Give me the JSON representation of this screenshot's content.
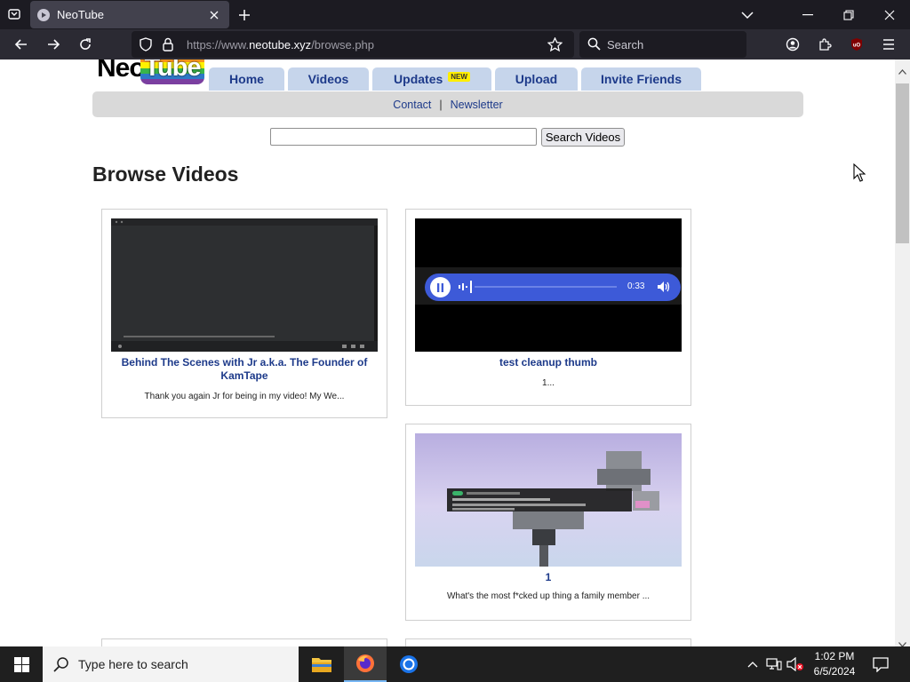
{
  "browser": {
    "tab_title": "NeoTube",
    "url_prefix": "https://www.",
    "url_host": "neotube.xyz",
    "url_path": "/browse.php",
    "search_placeholder": "Search"
  },
  "site": {
    "logo_neo": "Neo",
    "logo_tube": "Tube",
    "logo_colors": [
      "#e23a3a",
      "#f7941d",
      "#fff200",
      "#39b54a",
      "#2e79c7",
      "#7b3fa0"
    ],
    "menu": [
      {
        "label": "Home"
      },
      {
        "label": "Videos"
      },
      {
        "label": "Updates",
        "badge": "NEW"
      },
      {
        "label": "Upload"
      },
      {
        "label": "Invite Friends"
      }
    ],
    "subnav": {
      "contact": "Contact",
      "separator": "|",
      "newsletter": "Newsletter"
    },
    "search_button": "Search Videos",
    "search_value": "",
    "page_title": "Browse Videos"
  },
  "videos": [
    {
      "title": "Behind The Scenes with Jr a.k.a. The Founder of KamTape",
      "description": "Thank you again Jr for being in my video! My We..."
    },
    {
      "title": "test cleanup thumb",
      "description": "1...",
      "player_time": "0:33"
    },
    {
      "title": "1",
      "description": "What's the most f*cked up thing a family member ..."
    }
  ],
  "taskbar": {
    "search_placeholder": "Type here to search",
    "time": "1:02 PM",
    "date": "6/5/2024"
  }
}
